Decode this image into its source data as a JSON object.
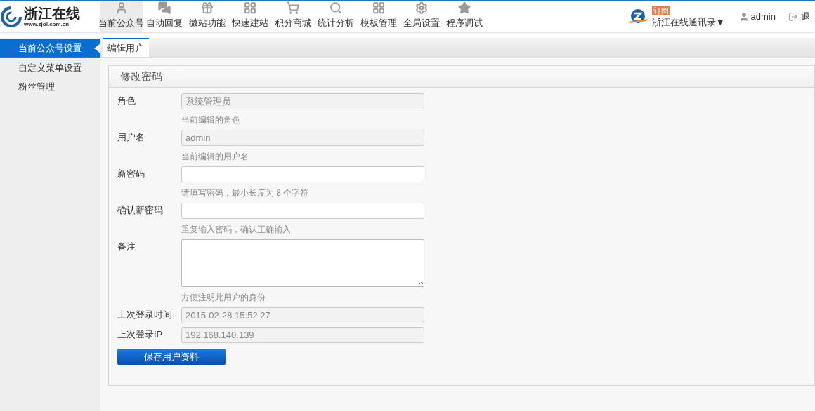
{
  "logo": {
    "name": "浙江在线",
    "url": "www.zjol.com.cn"
  },
  "nav": [
    {
      "label": "当前公众号",
      "selected": true
    },
    {
      "label": "自动回复",
      "selected": false
    },
    {
      "label": "微站功能",
      "selected": false
    },
    {
      "label": "快速建站",
      "selected": false
    },
    {
      "label": "积分商城",
      "selected": false
    },
    {
      "label": "统计分析",
      "selected": false
    },
    {
      "label": "模板管理",
      "selected": false
    },
    {
      "label": "全局设置",
      "selected": false
    },
    {
      "label": "程序调试",
      "selected": false
    }
  ],
  "account": {
    "badge": "订阅",
    "name": "浙江在线通讯录▼"
  },
  "user": "admin",
  "logout": "退",
  "sidebar": [
    {
      "label": "当前公众号设置",
      "selected": true
    },
    {
      "label": "自定义菜单设置",
      "selected": false
    },
    {
      "label": "粉丝管理",
      "selected": false
    }
  ],
  "tabs": [
    {
      "label": "编辑用户",
      "selected": true
    }
  ],
  "panel": {
    "title": "修改密码",
    "fields": [
      {
        "label": "角色",
        "kind": "input",
        "value": "系统管理员",
        "disabled": true,
        "help": "当前编辑的角色"
      },
      {
        "label": "用户名",
        "kind": "input",
        "value": "admin",
        "disabled": true,
        "help": "当前编辑的用户名"
      },
      {
        "label": "新密码",
        "kind": "input",
        "disabled": false,
        "help": "请填写密码，最小长度为 8 个字符"
      },
      {
        "label": "确认新密码",
        "kind": "input",
        "disabled": false,
        "help": "重复输入密码，确认正确输入"
      },
      {
        "label": "备注",
        "kind": "textarea",
        "disabled": false,
        "help": "方便注明此用户的身份"
      },
      {
        "label": "上次登录时间",
        "kind": "input",
        "value": "2015-02-28 15:52:27",
        "disabled": true
      },
      {
        "label": "上次登录IP",
        "kind": "input",
        "value": "192.168.140.139",
        "disabled": true
      }
    ],
    "button": "保存用户资料"
  }
}
